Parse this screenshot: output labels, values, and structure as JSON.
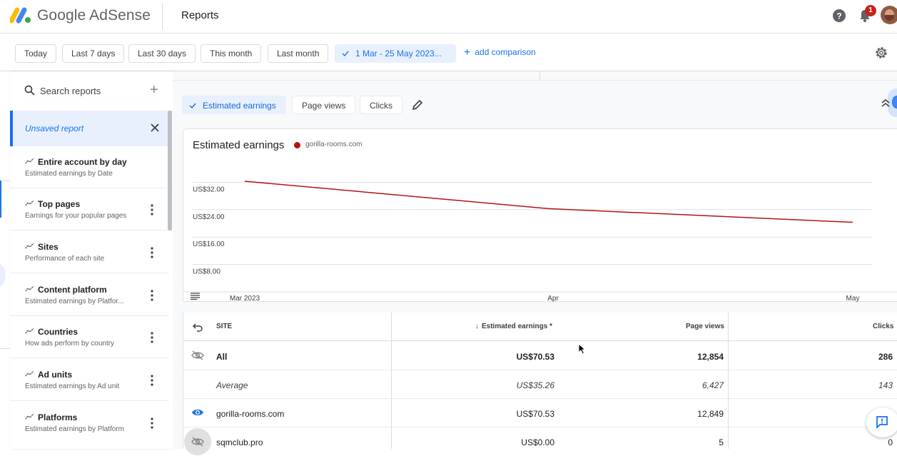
{
  "header": {
    "app_name": "Google AdSense",
    "page_title": "Reports",
    "notification_count": "1"
  },
  "date_bar": {
    "chips": [
      "Today",
      "Last 7 days",
      "Last 30 days",
      "This month",
      "Last month"
    ],
    "active_range": "1 Mar - 25 May 2023...",
    "add_comparison": "add comparison"
  },
  "sidebar": {
    "search_placeholder": "Search reports",
    "unsaved_report": "Unsaved report",
    "reports": [
      {
        "title": "Entire account by day",
        "subtitle": "Estimated earnings by Date"
      },
      {
        "title": "Top pages",
        "subtitle": "Earnings for your popular pages"
      },
      {
        "title": "Sites",
        "subtitle": "Performance of each site"
      },
      {
        "title": "Content platform",
        "subtitle": "Estimated earnings by Platfor..."
      },
      {
        "title": "Countries",
        "subtitle": "How ads perform by country"
      },
      {
        "title": "Ad units",
        "subtitle": "Estimated earnings by Ad unit"
      },
      {
        "title": "Platforms",
        "subtitle": "Estimated earnings by Platform"
      }
    ]
  },
  "metrics": {
    "selected": "Estimated earnings",
    "others": [
      "Page views",
      "Clicks"
    ]
  },
  "chart": {
    "title": "Estimated earnings",
    "legend": "gorilla-rooms.com",
    "series_color": "#b31412"
  },
  "chart_data": {
    "type": "line",
    "title": "Estimated earnings",
    "y_ticks": [
      "US$32.00",
      "US$24.00",
      "US$16.00",
      "US$8.00"
    ],
    "x_ticks": [
      "Mar 2023",
      "Apr",
      "May"
    ],
    "ylim": [
      0,
      40
    ],
    "series": [
      {
        "name": "gorilla-rooms.com",
        "points": [
          [
            0,
            32.3
          ],
          [
            1,
            24.3
          ],
          [
            2,
            20.3
          ]
        ]
      }
    ]
  },
  "table": {
    "headers": {
      "site": "SITE",
      "earnings": "Estimated earnings *",
      "page_views": "Page views",
      "clicks": "Clicks"
    },
    "rows": [
      {
        "site": "All",
        "earnings": "US$70.53",
        "page_views": "12,854",
        "clicks": "286"
      },
      {
        "site": "Average",
        "earnings": "US$35.26",
        "page_views": "6,427",
        "clicks": "143"
      },
      {
        "site": "gorilla-rooms.com",
        "earnings": "US$70.53",
        "page_views": "12,849",
        "clicks": ""
      },
      {
        "site": "sqmclub.pro",
        "earnings": "US$0.00",
        "page_views": "5",
        "clicks": "0"
      }
    ]
  }
}
